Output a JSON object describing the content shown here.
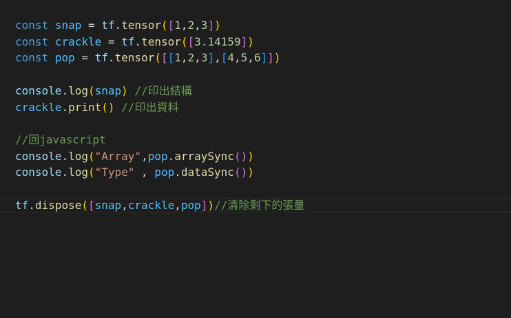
{
  "editor": {
    "theme_colors": {
      "background": "#1e1e1e",
      "keyword": "#569cd6",
      "variable": "#4fc1ff",
      "identifier": "#9cdcfe",
      "function": "#dcdcaa",
      "number": "#b5cea8",
      "string": "#ce9178",
      "comment": "#6a9955",
      "bracket_level_1": "#ffd700",
      "bracket_level_2": "#da70d6",
      "bracket_level_3": "#179fff"
    },
    "lines": [
      {
        "tokens": [
          {
            "text": "const",
            "kind": "keyword"
          },
          {
            "text": " ",
            "kind": "punct"
          },
          {
            "text": "snap",
            "kind": "var"
          },
          {
            "text": " = ",
            "kind": "punct"
          },
          {
            "text": "tf",
            "kind": "ident"
          },
          {
            "text": ".",
            "kind": "punct"
          },
          {
            "text": "tensor",
            "kind": "func"
          },
          {
            "text": "(",
            "kind": "b1"
          },
          {
            "text": "[",
            "kind": "b2"
          },
          {
            "text": "1",
            "kind": "number"
          },
          {
            "text": ",",
            "kind": "punct"
          },
          {
            "text": "2",
            "kind": "number"
          },
          {
            "text": ",",
            "kind": "punct"
          },
          {
            "text": "3",
            "kind": "number"
          },
          {
            "text": "]",
            "kind": "b2"
          },
          {
            "text": ")",
            "kind": "b1"
          }
        ]
      },
      {
        "tokens": [
          {
            "text": "const",
            "kind": "keyword"
          },
          {
            "text": " ",
            "kind": "punct"
          },
          {
            "text": "crackle",
            "kind": "var"
          },
          {
            "text": " = ",
            "kind": "punct"
          },
          {
            "text": "tf",
            "kind": "ident"
          },
          {
            "text": ".",
            "kind": "punct"
          },
          {
            "text": "tensor",
            "kind": "func"
          },
          {
            "text": "(",
            "kind": "b1"
          },
          {
            "text": "[",
            "kind": "b2"
          },
          {
            "text": "3.14159",
            "kind": "number"
          },
          {
            "text": "]",
            "kind": "b2"
          },
          {
            "text": ")",
            "kind": "b1"
          }
        ]
      },
      {
        "tokens": [
          {
            "text": "const",
            "kind": "keyword"
          },
          {
            "text": " ",
            "kind": "punct"
          },
          {
            "text": "pop",
            "kind": "var"
          },
          {
            "text": " = ",
            "kind": "punct"
          },
          {
            "text": "tf",
            "kind": "ident"
          },
          {
            "text": ".",
            "kind": "punct"
          },
          {
            "text": "tensor",
            "kind": "func"
          },
          {
            "text": "(",
            "kind": "b1"
          },
          {
            "text": "[",
            "kind": "b2"
          },
          {
            "text": "[",
            "kind": "b3"
          },
          {
            "text": "1",
            "kind": "number"
          },
          {
            "text": ",",
            "kind": "punct"
          },
          {
            "text": "2",
            "kind": "number"
          },
          {
            "text": ",",
            "kind": "punct"
          },
          {
            "text": "3",
            "kind": "number"
          },
          {
            "text": "]",
            "kind": "b3"
          },
          {
            "text": ",",
            "kind": "punct"
          },
          {
            "text": "[",
            "kind": "b3"
          },
          {
            "text": "4",
            "kind": "number"
          },
          {
            "text": ",",
            "kind": "punct"
          },
          {
            "text": "5",
            "kind": "number"
          },
          {
            "text": ",",
            "kind": "punct"
          },
          {
            "text": "6",
            "kind": "number"
          },
          {
            "text": "]",
            "kind": "b3"
          },
          {
            "text": "]",
            "kind": "b2"
          },
          {
            "text": ")",
            "kind": "b1"
          }
        ]
      },
      {
        "tokens": []
      },
      {
        "tokens": [
          {
            "text": "console",
            "kind": "ident"
          },
          {
            "text": ".",
            "kind": "punct"
          },
          {
            "text": "log",
            "kind": "func"
          },
          {
            "text": "(",
            "kind": "b1"
          },
          {
            "text": "snap",
            "kind": "var"
          },
          {
            "text": ")",
            "kind": "b1"
          },
          {
            "text": " ",
            "kind": "punct"
          },
          {
            "text": "//印出結構",
            "kind": "comment"
          }
        ]
      },
      {
        "tokens": [
          {
            "text": "crackle",
            "kind": "var"
          },
          {
            "text": ".",
            "kind": "punct"
          },
          {
            "text": "print",
            "kind": "func"
          },
          {
            "text": "(",
            "kind": "b1"
          },
          {
            "text": ")",
            "kind": "b1"
          },
          {
            "text": " ",
            "kind": "punct"
          },
          {
            "text": "//印出資料",
            "kind": "comment"
          }
        ]
      },
      {
        "tokens": []
      },
      {
        "tokens": [
          {
            "text": "//回javascript",
            "kind": "comment"
          }
        ]
      },
      {
        "tokens": [
          {
            "text": "console",
            "kind": "ident"
          },
          {
            "text": ".",
            "kind": "punct"
          },
          {
            "text": "log",
            "kind": "func"
          },
          {
            "text": "(",
            "kind": "b1"
          },
          {
            "text": "\"Array\"",
            "kind": "string"
          },
          {
            "text": ",",
            "kind": "punct"
          },
          {
            "text": "pop",
            "kind": "var"
          },
          {
            "text": ".",
            "kind": "punct"
          },
          {
            "text": "arraySync",
            "kind": "func"
          },
          {
            "text": "(",
            "kind": "b2"
          },
          {
            "text": ")",
            "kind": "b2"
          },
          {
            "text": ")",
            "kind": "b1"
          }
        ]
      },
      {
        "tokens": [
          {
            "text": "console",
            "kind": "ident"
          },
          {
            "text": ".",
            "kind": "punct"
          },
          {
            "text": "log",
            "kind": "func"
          },
          {
            "text": "(",
            "kind": "b1"
          },
          {
            "text": "\"Type\"",
            "kind": "string"
          },
          {
            "text": " , ",
            "kind": "punct"
          },
          {
            "text": "pop",
            "kind": "var"
          },
          {
            "text": ".",
            "kind": "punct"
          },
          {
            "text": "dataSync",
            "kind": "func"
          },
          {
            "text": "(",
            "kind": "b2"
          },
          {
            "text": ")",
            "kind": "b2"
          },
          {
            "text": ")",
            "kind": "b1"
          }
        ]
      },
      {
        "tokens": []
      },
      {
        "current": true,
        "tokens": [
          {
            "text": "tf",
            "kind": "ident"
          },
          {
            "text": ".",
            "kind": "punct"
          },
          {
            "text": "dispose",
            "kind": "func"
          },
          {
            "text": "(",
            "kind": "b1"
          },
          {
            "text": "[",
            "kind": "b2"
          },
          {
            "text": "snap",
            "kind": "var"
          },
          {
            "text": ",",
            "kind": "punct"
          },
          {
            "text": "crackle",
            "kind": "var"
          },
          {
            "text": ",",
            "kind": "punct"
          },
          {
            "text": "pop",
            "kind": "var"
          },
          {
            "text": "]",
            "kind": "b2"
          },
          {
            "text": ")",
            "kind": "b1"
          },
          {
            "text": "//清除剩下的張量",
            "kind": "comment"
          }
        ]
      }
    ]
  }
}
